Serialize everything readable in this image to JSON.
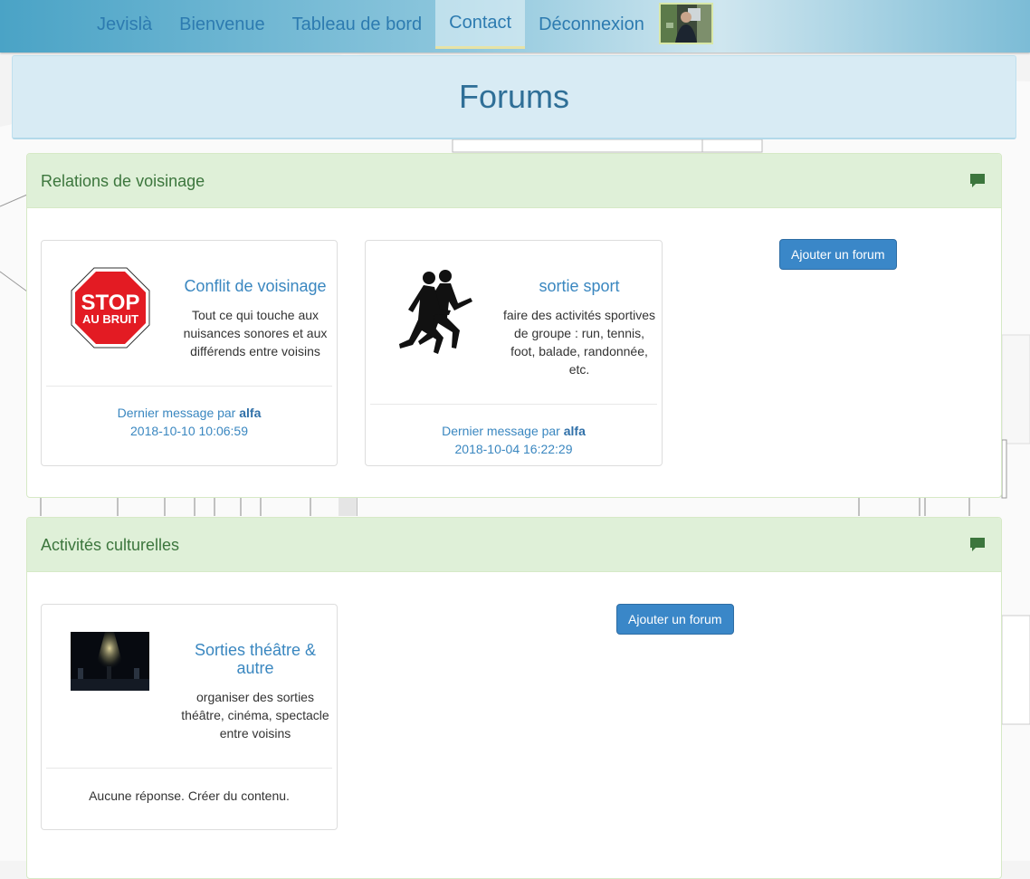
{
  "nav": {
    "items": [
      {
        "label": "Jevislà"
      },
      {
        "label": "Bienvenue"
      },
      {
        "label": "Tableau de bord"
      },
      {
        "label": "Contact",
        "active": true
      },
      {
        "label": "Déconnexion"
      }
    ],
    "avatar_icon": "user-avatar"
  },
  "page": {
    "title": "Forums"
  },
  "categories": [
    {
      "title": "Relations de voisinage",
      "icon": "comment-icon",
      "add_button": "Ajouter un forum",
      "forums": [
        {
          "image": "stop-au-bruit-sign",
          "image_text_1": "STOP",
          "image_text_2": "AU BRUIT",
          "title": "Conflit de voisinage",
          "description": "Tout ce qui touche aux nuisances sonores et aux différends entre voisins",
          "last_prefix": "Dernier message par",
          "last_user": "alfa",
          "last_date": "2018-10-10 10:06:59"
        },
        {
          "image": "runners-silhouette",
          "title": "sortie sport",
          "description": "faire des activités sportives de groupe : run, tennis, foot, balade, randonnée, etc.",
          "last_prefix": "Dernier message par",
          "last_user": "alfa",
          "last_date": "2018-10-04 16:22:29"
        }
      ]
    },
    {
      "title": "Activités culturelles",
      "icon": "comment-icon",
      "add_button": "Ajouter un forum",
      "forums": [
        {
          "image": "theatre-stage-photo",
          "title": "Sorties théâtre & autre",
          "description": "organiser des sorties théâtre, cinéma, spectacle entre voisins",
          "empty_text": "Aucune réponse. Créer du contenu."
        }
      ]
    }
  ],
  "colors": {
    "navbar": "#4aa3c6",
    "nav_link": "#2d7bb0",
    "title": "#2f6f97",
    "panel_header": "#dff0d8",
    "panel_text": "#3c763d",
    "button": "#3a87c8",
    "link": "#3a87c0"
  }
}
